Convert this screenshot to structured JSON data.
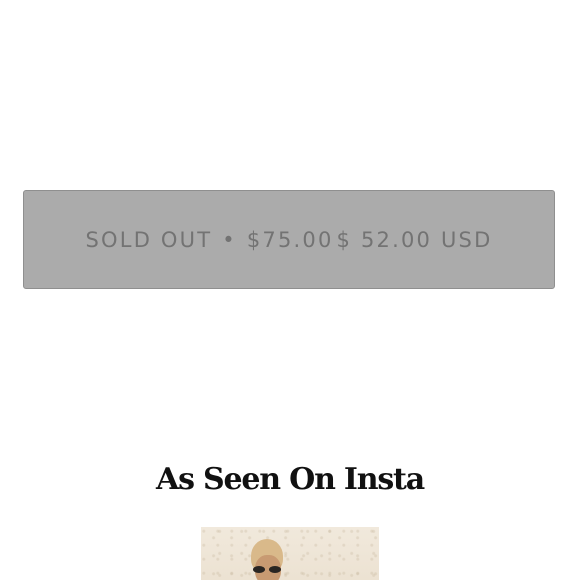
{
  "product": {
    "sold_out_label": "SOLD OUT",
    "separator": "•",
    "original_price": "$75.00",
    "sale_price": "$ 52.00 USD"
  },
  "instagram_section": {
    "title": "As Seen On Insta"
  }
}
